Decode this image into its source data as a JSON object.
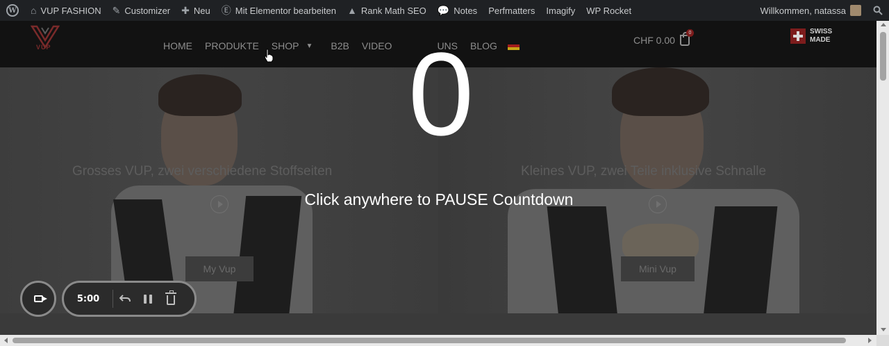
{
  "admin_bar": {
    "items": [
      {
        "label": "VUP FASHION",
        "icon": "home-icon"
      },
      {
        "label": "Customizer",
        "icon": "brush-icon"
      },
      {
        "label": "Neu",
        "icon": "plus-icon"
      },
      {
        "label": "Mit Elementor bearbeiten",
        "icon": "elementor-icon"
      },
      {
        "label": "Rank Math SEO",
        "icon": "chart-icon"
      },
      {
        "label": "Notes",
        "icon": "speech-bubble-icon"
      },
      {
        "label": "Perfmatters",
        "icon": ""
      },
      {
        "label": "Imagify",
        "icon": ""
      },
      {
        "label": "WP Rocket",
        "icon": ""
      }
    ],
    "greeting": "Willkommen, natassa"
  },
  "header": {
    "logo_text": "VUP",
    "nav": [
      "HOME",
      "PRODUKTE",
      "SHOP",
      "B2B",
      "VIDEO",
      "UNS",
      "BLOG"
    ],
    "cart_total": "CHF 0.00",
    "cart_count": "0",
    "swiss_line1": "SWISS",
    "swiss_line2": "MADE"
  },
  "hero": {
    "left_title": "Grosses VUP, zwei verschiedene Stoffseiten",
    "left_button": "My Vup",
    "right_title": "Kleines VUP, zwei Teile inklusive Schnalle",
    "right_button": "Mini Vup"
  },
  "overlay": {
    "countdown": "0",
    "message": "Click anywhere to PAUSE Countdown"
  },
  "recorder": {
    "time": "5:00"
  },
  "colors": {
    "admin_bar": "#1f2124",
    "header": "#121212",
    "accent_red": "#7c1c1c",
    "overlay_text": "#ffffff"
  }
}
